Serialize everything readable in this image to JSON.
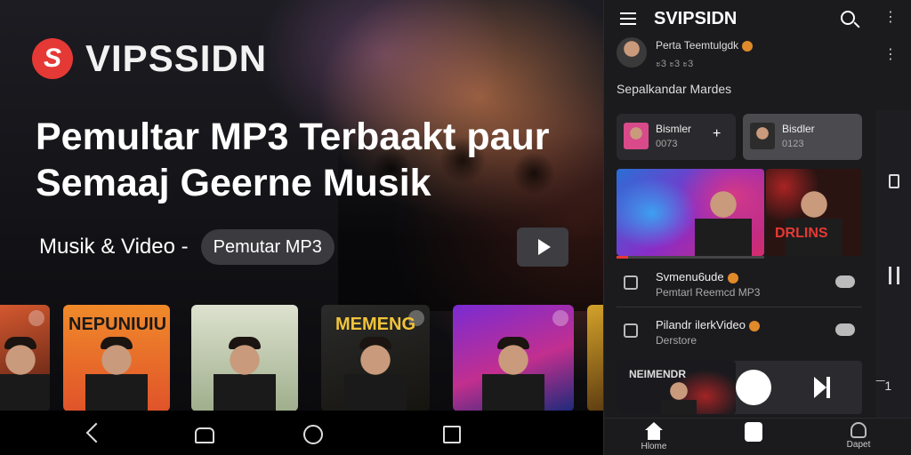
{
  "hero": {
    "brand_logo_letter": "S",
    "brand_name": "VIPSSIDN",
    "headline_line1": "Pemultar MP3 Terbaakt paur",
    "headline_line2": "Semaaj Geerne Musik",
    "subtitle": "Musik & Video  -",
    "chip_label": "Pemutar MP3",
    "brand_color": "#e53935"
  },
  "cards": [
    {
      "title": "",
      "icon": "album-cover"
    },
    {
      "title": "NEPUNIUIU",
      "icon": "album-cover"
    },
    {
      "title": "",
      "icon": "album-cover"
    },
    {
      "title": "MEMENG",
      "icon": "album-cover"
    },
    {
      "title": "",
      "icon": "album-cover"
    },
    {
      "title": "",
      "icon": "album-cover"
    }
  ],
  "navbar": {
    "back": "back-icon",
    "assist": "assistant-icon",
    "home": "home-circle-icon",
    "recent": "recent-apps-icon"
  },
  "panel": {
    "title": "SVIPSIDN",
    "profile": {
      "name": "Perta Teemtulgdk",
      "sub": "ะ3 ะ3 ะ3"
    },
    "section_title": "Sepalkandar Mardes",
    "tiles": [
      {
        "title": "Bismler",
        "sub": "0073",
        "action": "+"
      },
      {
        "title": "Bisdler",
        "sub": "0123"
      }
    ],
    "feature2_text": "DRLINS",
    "tracks": [
      {
        "title": "Svmenu6ude",
        "sub": "Pemtarl Reemcd MP3"
      },
      {
        "title": "Pilandr ilerkVideo",
        "sub": "Derstore"
      }
    ],
    "player": {
      "art_text": "NEIMENDR",
      "progress": 0.08
    },
    "mini_indicator": "‾‾1",
    "tabs": [
      {
        "label": "Hlome"
      },
      {
        "label": ""
      },
      {
        "label": "Dapet"
      }
    ]
  }
}
